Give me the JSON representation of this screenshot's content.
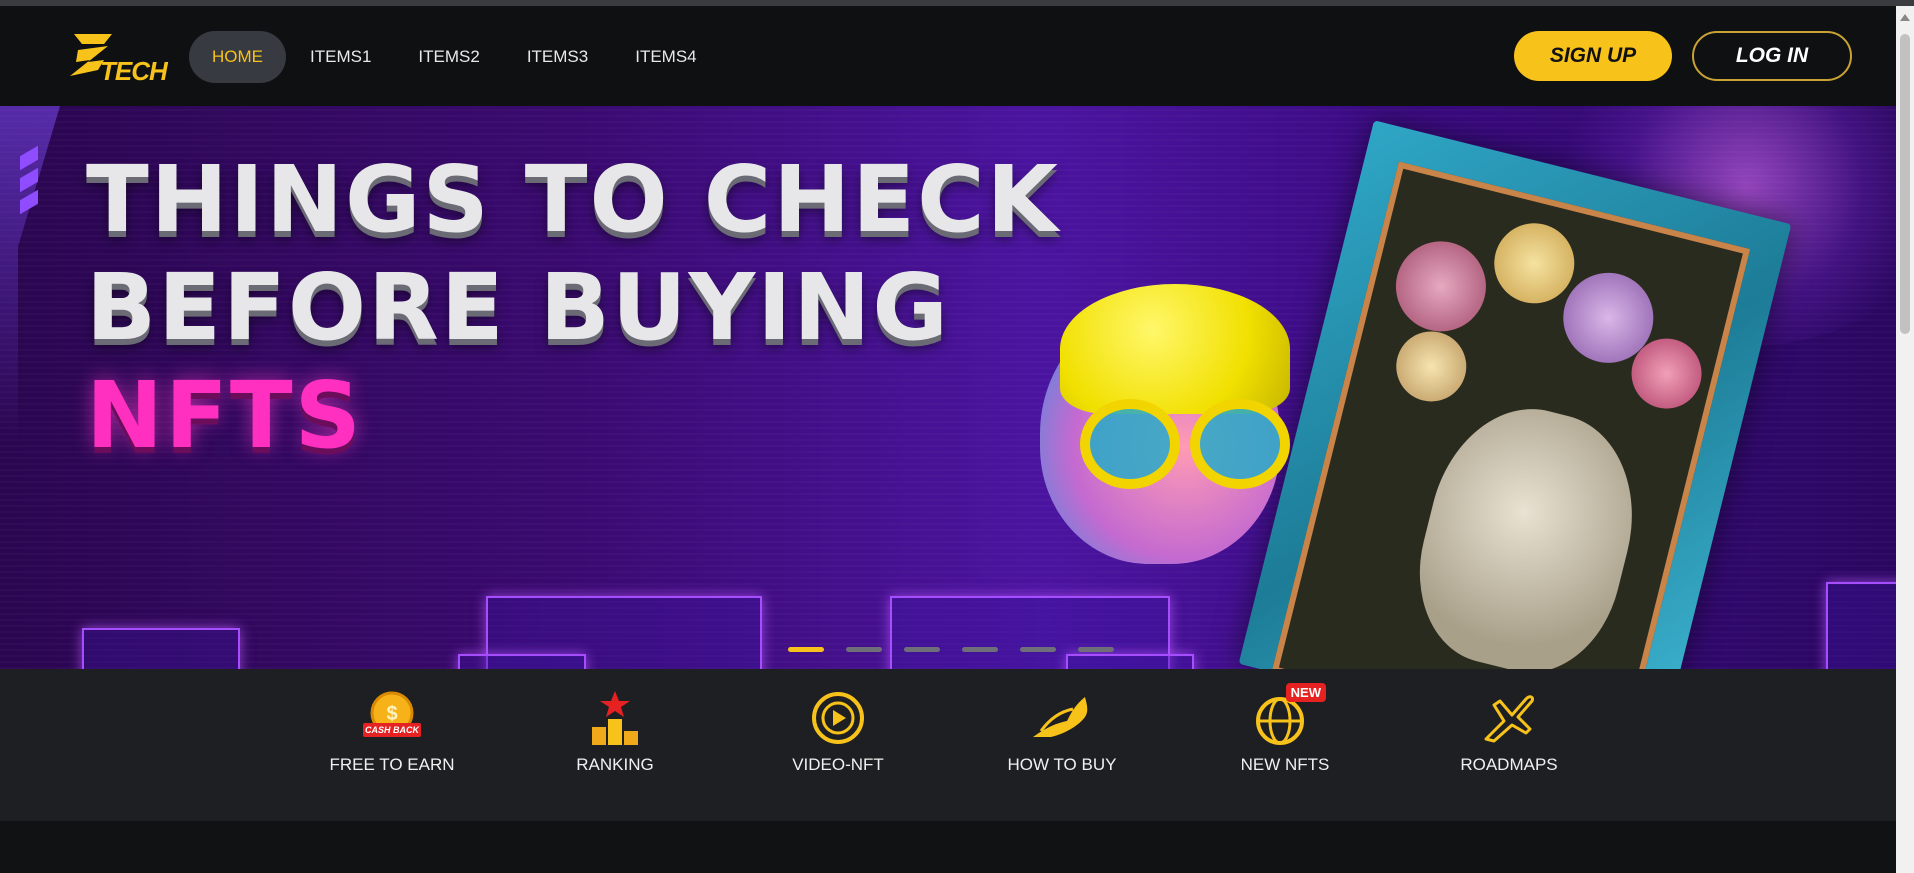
{
  "header": {
    "logo_text": "TECH",
    "nav": [
      {
        "label": "HOME",
        "active": true
      },
      {
        "label": "ITEMS1",
        "active": false
      },
      {
        "label": "ITEMS2",
        "active": false
      },
      {
        "label": "ITEMS3",
        "active": false
      },
      {
        "label": "ITEMS4",
        "active": false
      }
    ],
    "signup_label": "SIGN UP",
    "login_label": "LOG IN"
  },
  "hero": {
    "line1": "THINGS TO CHECK",
    "line2": "BEFORE BUYING",
    "line3": "NFTS",
    "slides_count": 6,
    "active_slide": 1
  },
  "features": [
    {
      "label": "FREE TO EARN",
      "icon": "cashback-coin-icon",
      "icon_text": "CASH BACK"
    },
    {
      "label": "RANKING",
      "icon": "podium-star-icon"
    },
    {
      "label": "VIDEO-NFT",
      "icon": "play-circle-icon"
    },
    {
      "label": "HOW TO BUY",
      "icon": "horse-icon"
    },
    {
      "label": "NEW NFTS",
      "icon": "globe-icon",
      "badge": "NEW"
    },
    {
      "label": "ROADMAPS",
      "icon": "airplane-icon"
    }
  ],
  "colors": {
    "accent": "#f7c21a",
    "pink": "#ff2fc0",
    "badge_red": "#e52121"
  }
}
